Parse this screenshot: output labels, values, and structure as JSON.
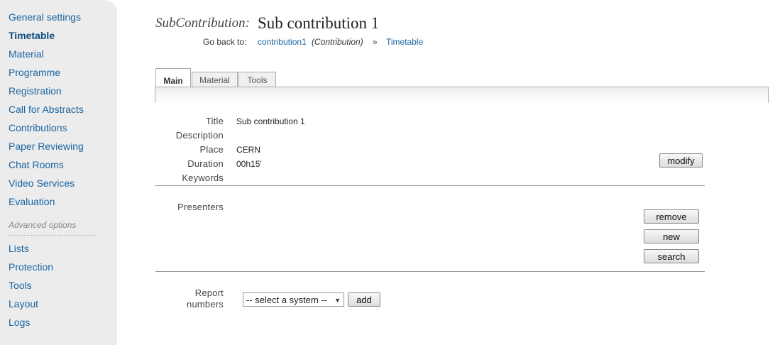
{
  "sidebar": {
    "items": [
      {
        "label": "General settings"
      },
      {
        "label": "Timetable"
      },
      {
        "label": "Material"
      },
      {
        "label": "Programme"
      },
      {
        "label": "Registration"
      },
      {
        "label": "Call for Abstracts"
      },
      {
        "label": "Contributions"
      },
      {
        "label": "Paper Reviewing"
      },
      {
        "label": "Chat Rooms"
      },
      {
        "label": "Video Services"
      },
      {
        "label": "Evaluation"
      }
    ],
    "advanced_label": "Advanced options",
    "advanced_items": [
      {
        "label": "Lists"
      },
      {
        "label": "Protection"
      },
      {
        "label": "Tools"
      },
      {
        "label": "Layout"
      },
      {
        "label": "Logs"
      }
    ]
  },
  "header": {
    "type_label": "SubContribution:",
    "title": "Sub contribution 1",
    "goback_label": "Go back to:",
    "crumb1": "contribution1",
    "crumb1_type": "(Contribution)",
    "separator": "»",
    "crumb2": "Timetable"
  },
  "tabs": [
    {
      "label": "Main"
    },
    {
      "label": "Material"
    },
    {
      "label": "Tools"
    }
  ],
  "details": {
    "title_label": "Title",
    "title_value": "Sub contribution 1",
    "description_label": "Description",
    "place_label": "Place",
    "place_value": "CERN",
    "duration_label": "Duration",
    "duration_value": "00h15'",
    "keywords_label": "Keywords",
    "modify_button": "modify"
  },
  "presenters": {
    "label": "Presenters",
    "remove_button": "remove",
    "new_button": "new",
    "search_button": "search"
  },
  "report": {
    "label_line1": "Report",
    "label_line2": "numbers",
    "select_value": "-- select a system --",
    "add_button": "add"
  }
}
